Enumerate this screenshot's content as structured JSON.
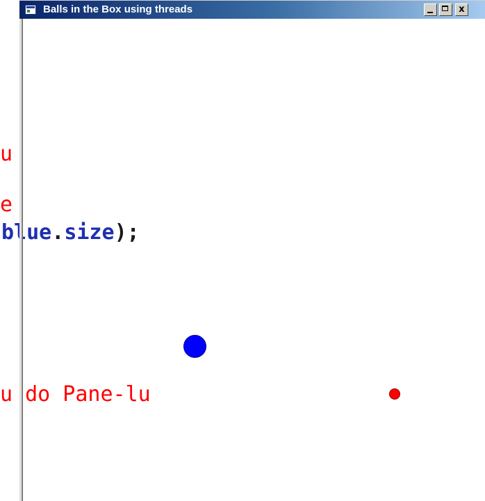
{
  "window": {
    "title": "Balls in the Box using threads",
    "buttons": {
      "minimize_icon": "minimize-icon",
      "maximize_icon": "maximize-icon",
      "close_label": "x"
    },
    "titlebar_colors": [
      "#0a246a",
      "#3a6ea5",
      "#a6caf0"
    ]
  },
  "background_code": {
    "line1": "u",
    "line2": "e",
    "line3_name": "blue",
    "line3_dot": ".",
    "line3_field": "size",
    "line3_end": ");",
    "line4": "u do Pane-lu"
  },
  "balls": [
    {
      "name": "blue-ball",
      "color": "#0000ff"
    },
    {
      "name": "red-ball",
      "color": "#ff0000"
    }
  ]
}
